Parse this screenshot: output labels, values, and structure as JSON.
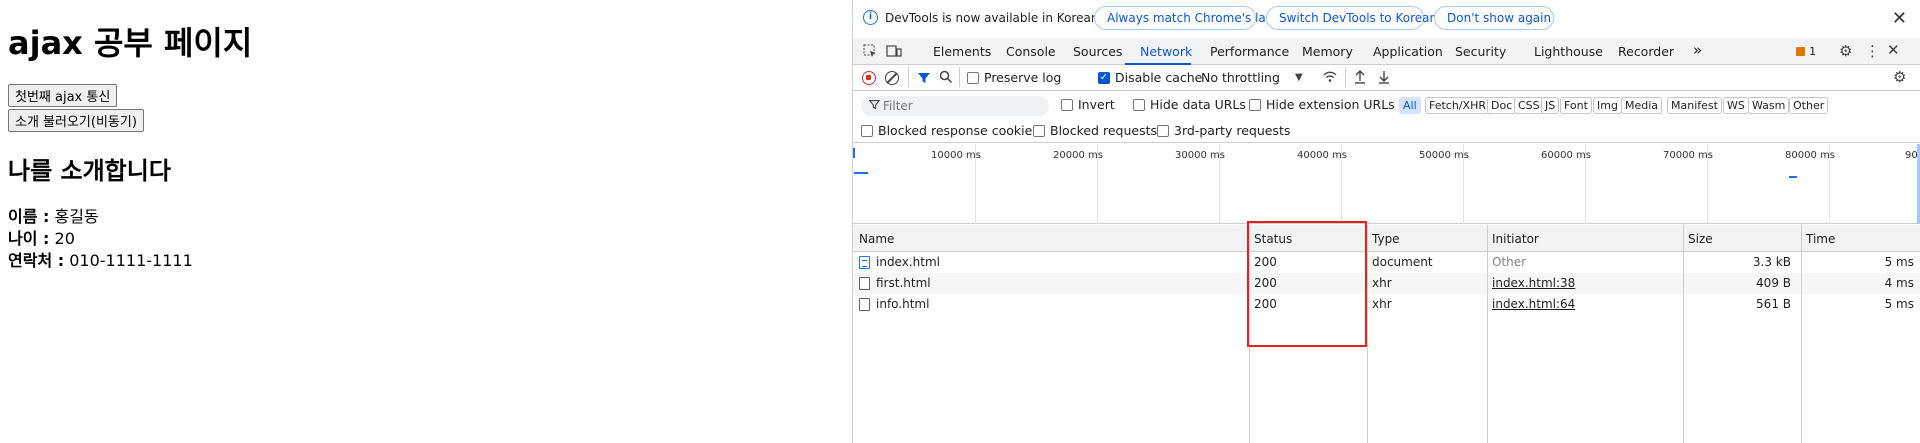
{
  "page": {
    "title": "ajax 공부 페이지",
    "button1": "첫번째 ajax 통신",
    "button2": "소개 불러오기(비동기)",
    "heading": "나를 소개합니다",
    "info": [
      {
        "label": "이름 :",
        "value": " 홍길동"
      },
      {
        "label": "나이 :",
        "value": " 20"
      },
      {
        "label": "연락처 :",
        "value": " 010-1111-1111"
      }
    ]
  },
  "devtools": {
    "infobar": {
      "text": "DevTools is now available in Korean!",
      "btn_match": "Always match Chrome's language",
      "btn_switch": "Switch DevTools to Korean",
      "btn_dont_show": "Don't show again",
      "close": "✕"
    },
    "tabs": [
      "Elements",
      "Console",
      "Sources",
      "Network",
      "Performance",
      "Memory",
      "Application",
      "Security",
      "Lighthouse",
      "Recorder"
    ],
    "more_tabs": "»",
    "issues_count": "1",
    "toolbar": {
      "preserve_log": "Preserve log",
      "disable_cache": "Disable cache",
      "throttling": "No throttling"
    },
    "filter": {
      "placeholder": "Filter",
      "invert": "Invert",
      "hide_data_urls": "Hide data URLs",
      "hide_ext_urls": "Hide extension URLs",
      "chips": [
        "All",
        "Fetch/XHR",
        "Doc",
        "CSS",
        "JS",
        "Font",
        "Img",
        "Media",
        "Manifest",
        "WS",
        "Wasm",
        "Other"
      ]
    },
    "blocked": {
      "cookies": "Blocked response cookies",
      "requests": "Blocked requests",
      "third_party": "3rd-party requests"
    },
    "overview_ticks": [
      "10000 ms",
      "20000 ms",
      "30000 ms",
      "40000 ms",
      "50000 ms",
      "60000 ms",
      "70000 ms",
      "80000 ms",
      "90"
    ],
    "columns": {
      "name": "Name",
      "status": "Status",
      "type": "Type",
      "initiator": "Initiator",
      "size": "Size",
      "time": "Time"
    },
    "rows": [
      {
        "name": "index.html",
        "status": "200",
        "type": "document",
        "initiator": "Other",
        "size": "3.3 kB",
        "time": "5 ms"
      },
      {
        "name": "first.html",
        "status": "200",
        "type": "xhr",
        "initiator": "index.html:38",
        "size": "409 B",
        "time": "4 ms"
      },
      {
        "name": "info.html",
        "status": "200",
        "type": "xhr",
        "initiator": "index.html:64",
        "size": "561 B",
        "time": "5 ms"
      }
    ],
    "colors": {
      "accent": "#0b57d0",
      "highlight": "#e8221a",
      "record": "#d93025"
    }
  }
}
